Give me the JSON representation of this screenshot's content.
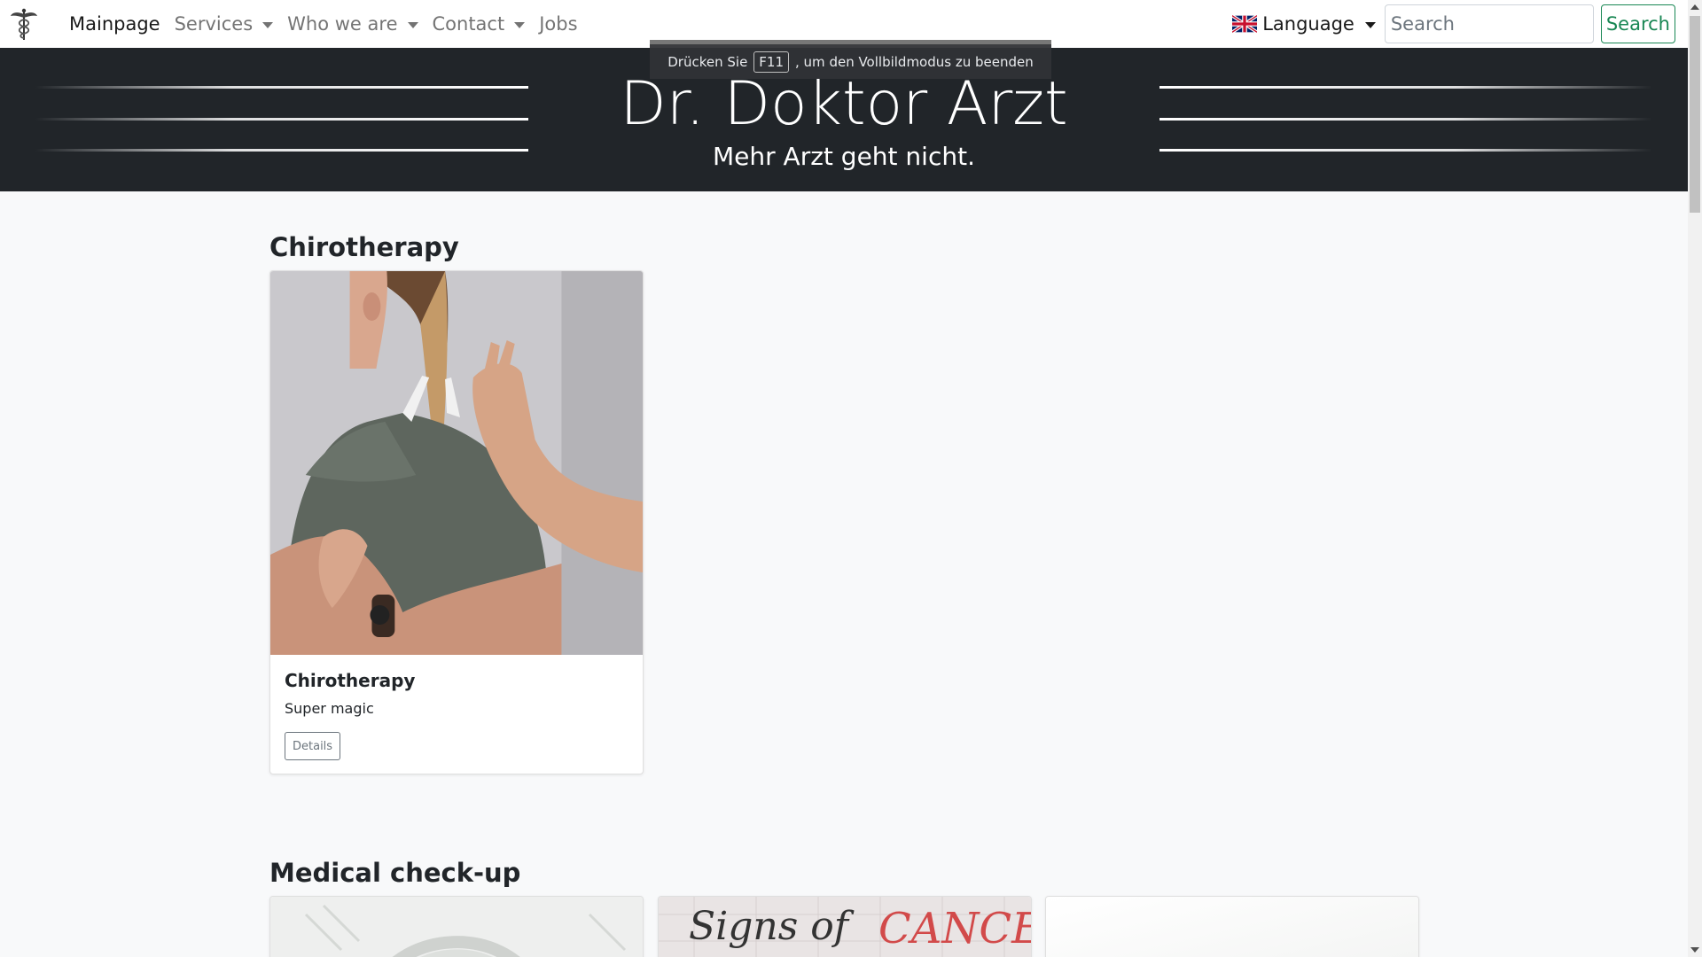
{
  "navbar": {
    "brand_icon": "caduceus-icon",
    "items": [
      {
        "label": "Mainpage",
        "active": true,
        "dropdown": false
      },
      {
        "label": "Services",
        "active": false,
        "dropdown": true
      },
      {
        "label": "Who we are",
        "active": false,
        "dropdown": true
      },
      {
        "label": "Contact",
        "active": false,
        "dropdown": true
      },
      {
        "label": "Jobs",
        "active": false,
        "dropdown": false
      }
    ],
    "language_label": "Language",
    "language_flag": "uk-flag-icon",
    "search_placeholder": "Search",
    "search_button": "Search",
    "search_color": "#198754"
  },
  "hero": {
    "title": "Dr. Doktor Arzt",
    "subtitle": "Mehr Arzt geht nicht.",
    "background": "#212529"
  },
  "fullscreen_notice": {
    "before": "Drücken Sie",
    "key": "F11",
    "after": ", um den Vollbildmodus zu beenden"
  },
  "sections": [
    {
      "title": "Chirotherapy",
      "cards": [
        {
          "title": "Chirotherapy",
          "text": "Super magic",
          "button": "Details"
        }
      ]
    },
    {
      "title": "Medical check-up",
      "cards": [
        {
          "image_text_1": "Signs of",
          "image_text_2": "CANCER"
        }
      ]
    }
  ]
}
